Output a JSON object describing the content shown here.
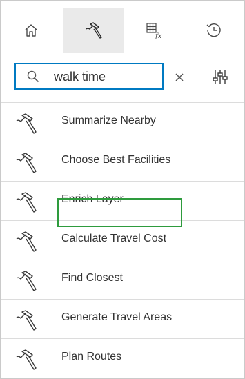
{
  "tabs": [
    {
      "id": "home",
      "icon": "home-icon",
      "active": false
    },
    {
      "id": "tools",
      "icon": "hammer-icon",
      "active": true
    },
    {
      "id": "functions",
      "icon": "table-function-icon",
      "active": false
    },
    {
      "id": "history",
      "icon": "history-icon",
      "active": false
    }
  ],
  "search": {
    "value": "walk time",
    "icon": "search-icon",
    "clear_icon": "close-icon"
  },
  "filter_icon": "filter-sliders-icon",
  "tools": [
    {
      "label": "Summarize Nearby",
      "icon": "hammer-icon"
    },
    {
      "label": "Choose Best Facilities",
      "icon": "hammer-icon"
    },
    {
      "label": "Enrich Layer",
      "icon": "hammer-icon"
    },
    {
      "label": "Calculate Travel Cost",
      "icon": "hammer-icon"
    },
    {
      "label": "Find Closest",
      "icon": "hammer-icon"
    },
    {
      "label": "Generate Travel Areas",
      "icon": "hammer-icon",
      "highlighted": true
    },
    {
      "label": "Plan Routes",
      "icon": "hammer-icon"
    }
  ],
  "colors": {
    "accent": "#007ac2",
    "highlight": "#2e9b3d",
    "active_tab_bg": "#eaeaea",
    "text": "#323232"
  }
}
